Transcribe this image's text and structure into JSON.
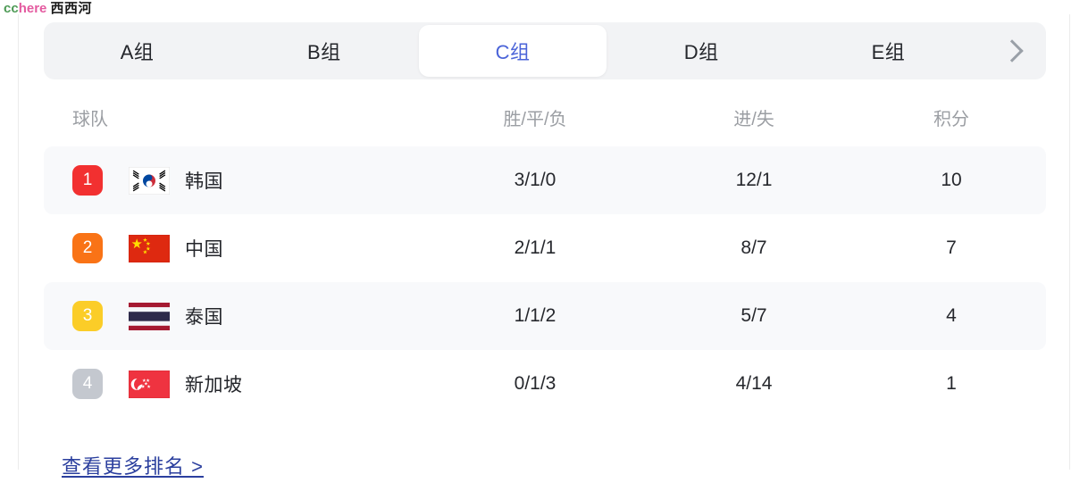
{
  "watermark": {
    "part1": "cc",
    "part2": "here",
    "part3": "西西河"
  },
  "tabs": {
    "items": [
      {
        "label": "A组",
        "active": false
      },
      {
        "label": "B组",
        "active": false
      },
      {
        "label": "C组",
        "active": true
      },
      {
        "label": "D组",
        "active": false
      },
      {
        "label": "E组",
        "active": false
      }
    ],
    "next_icon": "chevron-right-icon",
    "active_color": "#4a63d8",
    "bar_background": "#f2f3f5"
  },
  "table": {
    "headers": {
      "team": "球队",
      "wdl": "胜/平/负",
      "goals": "进/失",
      "points": "积分"
    },
    "rows": [
      {
        "rank": "1",
        "rank_color": "#f23030",
        "flag": "flag-south-korea-icon",
        "team": "韩国",
        "wdl": "3/1/0",
        "goals": "12/1",
        "points": "10",
        "tinted": true
      },
      {
        "rank": "2",
        "rank_color": "#f97316",
        "flag": "flag-china-icon",
        "team": "中国",
        "wdl": "2/1/1",
        "goals": "8/7",
        "points": "7",
        "tinted": false
      },
      {
        "rank": "3",
        "rank_color": "#fbcd28",
        "flag": "flag-thailand-icon",
        "team": "泰国",
        "wdl": "1/1/2",
        "goals": "5/7",
        "points": "4",
        "tinted": true
      },
      {
        "rank": "4",
        "rank_color": "#c4c8cf",
        "flag": "flag-singapore-icon",
        "team": "新加坡",
        "wdl": "0/1/3",
        "goals": "4/14",
        "points": "1",
        "tinted": false
      }
    ]
  },
  "footer": {
    "more_link": "查看更多排名 >",
    "link_color": "#2b3f9e"
  }
}
